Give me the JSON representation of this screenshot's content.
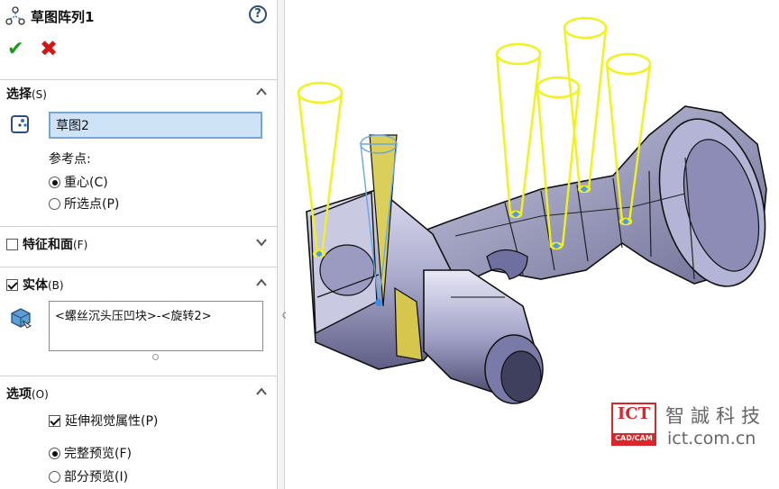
{
  "panel": {
    "title": "草图阵列1",
    "help_glyph": "?",
    "ok_glyph": "✔",
    "cancel_glyph": "✖"
  },
  "selection": {
    "header": "选择",
    "header_key": "(S)",
    "sketch_value": "草图2",
    "ref_point_label": "参考点:",
    "option_centroid": "重心(C)",
    "option_selected_point": "所选点(P)",
    "selected_option": "centroid"
  },
  "features_faces": {
    "header": "特征和面",
    "header_key": "(F)",
    "checked": false
  },
  "bodies": {
    "header": "实体",
    "header_key": "(B)",
    "checked": true,
    "list_value": "<螺丝沉头压凹块>-<旋转2>"
  },
  "options": {
    "header": "选项",
    "header_key": "(O)",
    "propagate_visual": "延伸视觉属性(P)",
    "propagate_checked": true,
    "full_preview": "完整预览(F)",
    "partial_preview": "部分预览(I)",
    "selected_preview": "full"
  },
  "watermark": {
    "logo_text": "ICT",
    "logo_sub": "CAD/CAM",
    "company_cn": "智誠科技",
    "url": "ict.com.cn"
  },
  "colors": {
    "accent_blue": "#7a9cc6",
    "ok_green": "#1a9a1a",
    "cancel_red": "#d21515",
    "logo_red": "#d8262b",
    "cone_yellow": "#f2f21a",
    "body_lavender": "#b9b9d6"
  }
}
